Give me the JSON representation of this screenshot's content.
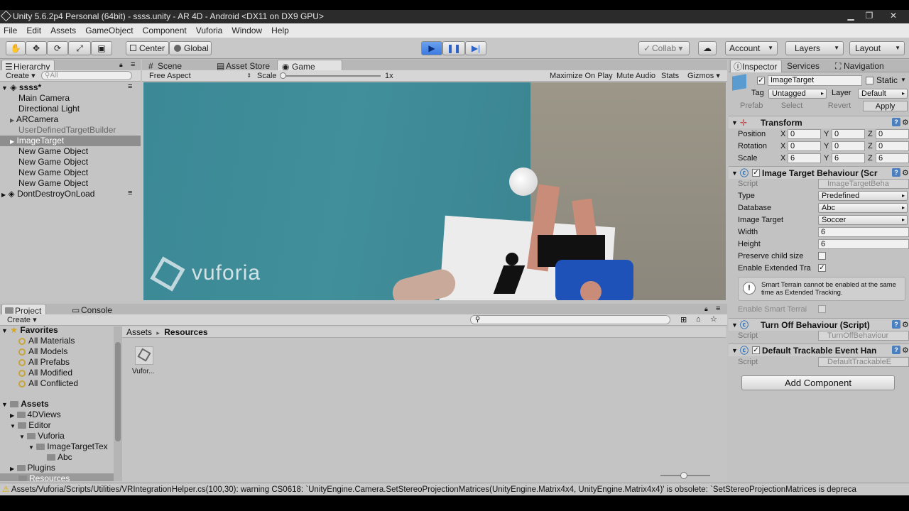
{
  "window": {
    "title": "Unity 5.6.2p4 Personal (64bit) - ssss.unity - AR 4D - Android <DX11 on DX9 GPU>",
    "minimize": "▁",
    "maximize": "❐",
    "close": "✕"
  },
  "menu": [
    "File",
    "Edit",
    "Assets",
    "GameObject",
    "Component",
    "Vuforia",
    "Window",
    "Help"
  ],
  "toolbar": {
    "center": "Center",
    "global": "Global",
    "collab": "Collab ▾",
    "account": "Account",
    "layers": "Layers",
    "layout": "Layout",
    "accent": "#3d7be0"
  },
  "hierarchy": {
    "tab": "Hierarchy",
    "create": "Create ▾",
    "search_placeholder": "All",
    "scene": "ssss*",
    "items": [
      "Main Camera",
      "Directional Light",
      "ARCamera",
      "UserDefinedTargetBuilder",
      "ImageTarget",
      "New Game Object",
      "New Game Object",
      "New Game Object",
      "New Game Object"
    ],
    "dontdestroy": "DontDestroyOnLoad"
  },
  "center_tabs": {
    "scene": "Scene",
    "asset_store": "Asset Store",
    "game": "Game"
  },
  "game_bar": {
    "aspect": "Free Aspect",
    "scale_label": "Scale",
    "scale_value": "1x",
    "maximize": "Maximize On Play",
    "mute": "Mute Audio",
    "stats": "Stats",
    "gizmos": "Gizmos ▾"
  },
  "game_view": {
    "watermark": "vuforia"
  },
  "project": {
    "tab_project": "Project",
    "tab_console": "Console",
    "create": "Create ▾",
    "favorites": "Favorites",
    "favorite_items": [
      "All Materials",
      "All Models",
      "All Prefabs",
      "All Modified",
      "All Conflicted"
    ],
    "assets": "Assets",
    "tree": [
      {
        "label": "4DViews",
        "indent": 1
      },
      {
        "label": "Editor",
        "indent": 1
      },
      {
        "label": "Vuforia",
        "indent": 2
      },
      {
        "label": "ImageTargetTex",
        "indent": 3
      },
      {
        "label": "Abc",
        "indent": 4
      },
      {
        "label": "Plugins",
        "indent": 1
      },
      {
        "label": "Resources",
        "indent": 1
      }
    ],
    "breadcrumb_root": "Assets",
    "breadcrumb_sep": "▸",
    "breadcrumb_current": "Resources",
    "asset_item": "Vufor..."
  },
  "inspector": {
    "tab_inspector": "Inspector",
    "tab_services": "Services",
    "tab_navigation": "Navigation",
    "object_name": "ImageTarget",
    "static_label": "Static",
    "tag_label": "Tag",
    "tag_value": "Untagged",
    "layer_label": "Layer",
    "layer_value": "Default",
    "prefab_label": "Prefab",
    "prefab_select": "Select",
    "prefab_revert": "Revert",
    "prefab_apply": "Apply",
    "transform": {
      "title": "Transform",
      "position_label": "Position",
      "rotation_label": "Rotation",
      "scale_label": "Scale",
      "position": [
        "0",
        "0",
        "0"
      ],
      "rotation": [
        "0",
        "0",
        "0"
      ],
      "scale": [
        "6",
        "6",
        "6"
      ],
      "x": "X",
      "y": "Y",
      "z": "Z"
    },
    "itb": {
      "title": "Image Target Behaviour (Scr",
      "script_label": "Script",
      "script_value": "ImageTargetBeha",
      "type_label": "Type",
      "type_value": "Predefined",
      "database_label": "Database",
      "database_value": "Abc",
      "image_target_label": "Image Target",
      "image_target_value": "Soccer",
      "width_label": "Width",
      "width_value": "6",
      "height_label": "Height",
      "height_value": "6",
      "preserve_label": "Preserve child size",
      "extended_label": "Enable Extended Tra",
      "warning": "Smart Terrain cannot be enabled at the same time as Extended Tracking.",
      "smart_terrain_label": "Enable Smart Terrai"
    },
    "turnoff": {
      "title": "Turn Off Behaviour (Script)",
      "script_label": "Script",
      "script_value": "TurnOffBehaviour"
    },
    "dteh": {
      "title": "Default Trackable Event Han",
      "script_label": "Script",
      "script_value": "DefaultTrackableE"
    },
    "add_component": "Add Component"
  },
  "status": {
    "message": "Assets/Vuforia/Scripts/Utilities/VRIntegrationHelper.cs(100,30): warning CS0618: `UnityEngine.Camera.SetStereoProjectionMatrices(UnityEngine.Matrix4x4, UnityEngine.Matrix4x4)' is obsolete: `SetStereoProjectionMatrices is depreca"
  }
}
